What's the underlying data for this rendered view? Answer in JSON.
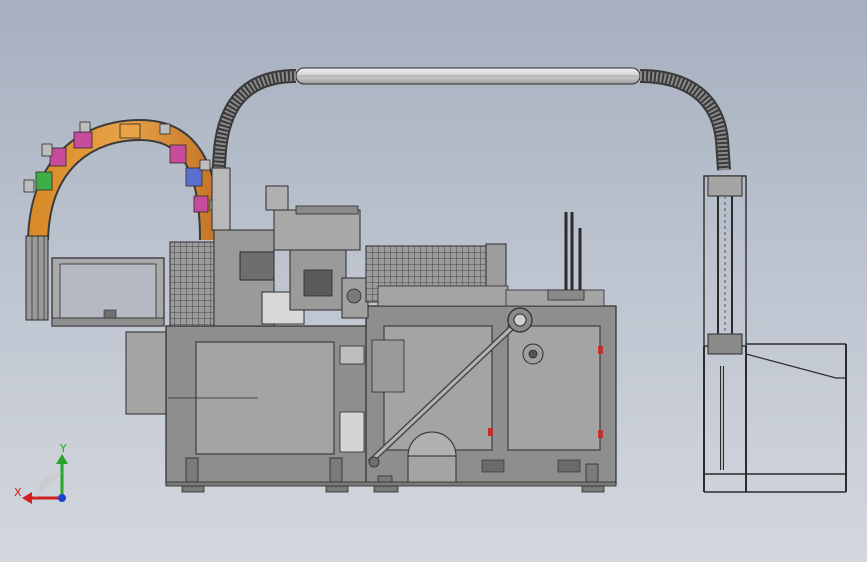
{
  "viewport": {
    "background_top": "#a7afbf",
    "background_bottom": "#d3d7de"
  },
  "model": {
    "frame_color": "#8e8e8e",
    "frame_stroke": "#2b2b2b",
    "panel_color": "#a4a4a4",
    "tube_color": "#d6d6d6",
    "cup_colors": [
      "#3fae49",
      "#c94b9b",
      "#d98b2a",
      "#5b6fd0",
      "#c94b9b",
      "#3fae49"
    ]
  },
  "triad": {
    "x_label": "X",
    "y_label": "Y",
    "x_color": "#d42020",
    "y_color": "#2aa32a",
    "z_color": "#2040d0"
  }
}
